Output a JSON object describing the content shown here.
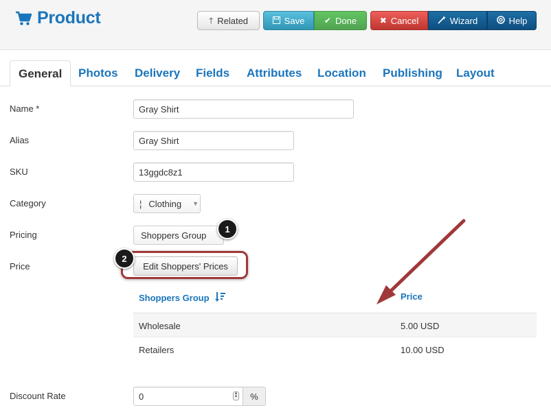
{
  "header": {
    "title": "Product",
    "buttons": {
      "related": "Related",
      "save": "Save",
      "done": "Done",
      "cancel": "Cancel",
      "wizard": "Wizard",
      "help": "Help"
    }
  },
  "tabs": [
    "General",
    "Photos",
    "Delivery",
    "Fields",
    "Attributes",
    "Location",
    "Publishing",
    "Layout"
  ],
  "active_tab": "General",
  "form": {
    "name": {
      "label": "Name *",
      "value": "Gray Shirt"
    },
    "alias": {
      "label": "Alias",
      "value": "Gray Shirt"
    },
    "sku": {
      "label": "SKU",
      "value": "13ggdc8z1"
    },
    "category": {
      "label": "Category",
      "prefix": "¦",
      "value": "Clothing"
    },
    "pricing": {
      "label": "Pricing",
      "value": "Shoppers Group"
    },
    "price": {
      "label": "Price",
      "button": "Edit Shoppers' Prices"
    },
    "discount": {
      "label": "Discount Rate",
      "value": "0",
      "unit": "%"
    }
  },
  "price_table": {
    "columns": [
      "Shoppers Group",
      "Price"
    ],
    "rows": [
      {
        "group": "Wholesale",
        "price": "5.00 USD"
      },
      {
        "group": "Retailers",
        "price": "10.00 USD"
      }
    ]
  },
  "callouts": {
    "one": "1",
    "two": "2"
  },
  "colors": {
    "brand": "#1a75bc",
    "callout_red": "#a0383a"
  },
  "icons": [
    "cart-icon",
    "arrow-up-icon",
    "save-icon",
    "check-icon",
    "times-icon",
    "wand-icon",
    "lifebuoy-icon",
    "sort-icon"
  ]
}
